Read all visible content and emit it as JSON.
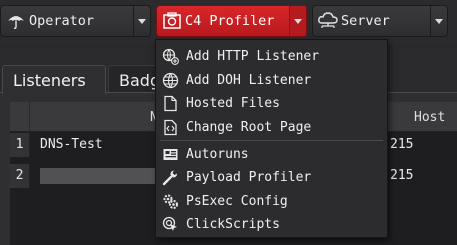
{
  "toolbar": {
    "operator_label": "Operator",
    "profiler_label": "C4 Profiler",
    "server_label": "Server"
  },
  "tabs": [
    {
      "label": "Listeners"
    },
    {
      "label": "Badge"
    }
  ],
  "table": {
    "headers": {
      "name": "N",
      "host": "Host"
    },
    "rows": [
      {
        "num": "1",
        "name": "DNS-Test",
        "host": "215"
      },
      {
        "num": "2",
        "name": "",
        "host": "215"
      }
    ]
  },
  "menu": {
    "items": [
      {
        "label": "Add HTTP Listener",
        "icon": "add-http-listener-icon"
      },
      {
        "label": "Add DOH Listener",
        "icon": "globe-icon"
      },
      {
        "label": "Hosted Files",
        "icon": "file-icon"
      },
      {
        "label": "Change Root Page",
        "icon": "html-file-icon"
      },
      {
        "label": "Autoruns",
        "icon": "autoruns-icon"
      },
      {
        "label": "Payload Profiler",
        "icon": "wrench-icon"
      },
      {
        "label": "PsExec Config",
        "icon": "gears-icon"
      },
      {
        "label": "ClickScripts",
        "icon": "click-icon"
      }
    ]
  },
  "colors": {
    "accent": "#c81f22",
    "background": "#2a2a2c"
  }
}
